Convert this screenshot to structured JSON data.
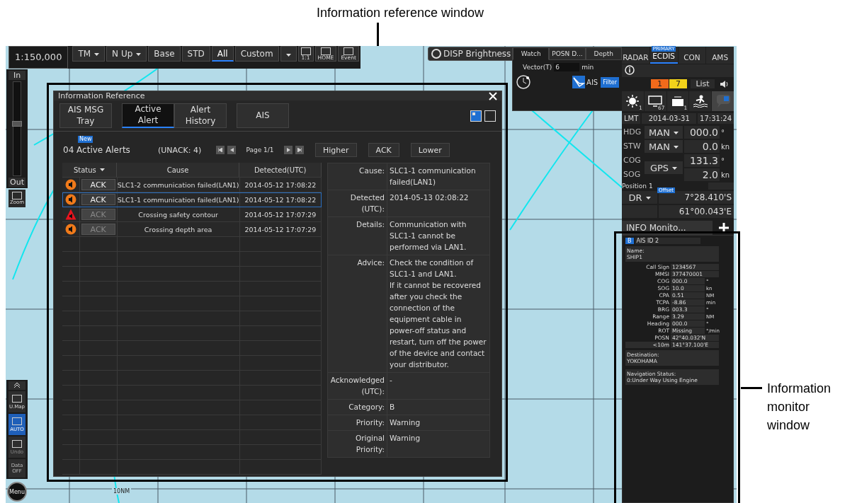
{
  "callouts": [
    {
      "text": "Information reference window"
    },
    {
      "text": "Information monitor window"
    }
  ],
  "toolbar": {
    "scale": "1:150,000",
    "motion": "TM",
    "orientation": "N Up",
    "display_modes": [
      {
        "label": "Base",
        "selected": false
      },
      {
        "label": "STD",
        "selected": false
      },
      {
        "label": "All",
        "selected": true
      },
      {
        "label": "Custom",
        "selected": false
      }
    ],
    "icon_captions": [
      "1:1",
      "HOME",
      "Event"
    ],
    "brightness": "DISP Brightness"
  },
  "left_bar": {
    "zoom_in": "In",
    "zoom_out": "Out",
    "level": 0.55,
    "zoom": "Zoom",
    "tools": [
      {
        "label": "U.Map",
        "selected": false,
        "disabled": false
      },
      {
        "label": "AUTO",
        "selected": true,
        "disabled": false
      },
      {
        "label": "Undo",
        "selected": false,
        "disabled": true
      }
    ],
    "data": "Data OFF",
    "menu": "Menu"
  },
  "map": {
    "scale_label": "10NM"
  },
  "watch_panel": {
    "tabs": [
      {
        "label": "Watch",
        "selected": true
      },
      {
        "label": "POSN D...",
        "selected": false
      },
      {
        "label": "Depth",
        "selected": false
      }
    ],
    "vector_label": "Vector(T)",
    "vector_value": "6",
    "vector_unit": "min",
    "ais": "AIS",
    "filter": "Filter"
  },
  "right_panel": {
    "tabs": [
      {
        "label": "RADAR",
        "selected": false
      },
      {
        "label": "ECDIS",
        "selected": true,
        "badge": "PRIMARY"
      },
      {
        "label": "CON",
        "selected": false
      },
      {
        "label": "AMS",
        "selected": false
      }
    ],
    "alert_counts": [
      {
        "value": "1",
        "color": "#f26a1b"
      },
      {
        "value": "7",
        "color": "#f2d21a"
      }
    ],
    "list": "List",
    "icon_counts": [
      "1",
      "67",
      "1"
    ],
    "clock": {
      "zone": "LMT",
      "date": "2014-03-31",
      "time": "17:31:24"
    },
    "sensors": [
      {
        "label": "HDG",
        "source": "MAN",
        "value": "000.0",
        "unit": "°"
      },
      {
        "label": "STW",
        "source": "MAN",
        "value": "0.0",
        "unit": "kn"
      },
      {
        "label": "COG",
        "source": "GPS",
        "value": "131.3",
        "unit": "°"
      },
      {
        "label": "SOG",
        "value": "2.0",
        "unit": "kn"
      }
    ],
    "position": {
      "label": "Position 1",
      "mode": "DR",
      "badge": "Offset",
      "lat": "7°28.410'S",
      "lon": "61°00.043'E"
    },
    "info_monitor_tab": "INFO Monito..."
  },
  "info_reference": {
    "title": "Information Reference",
    "tabs": [
      {
        "label": "AIS MSG Tray",
        "selected": false
      },
      {
        "label": "Active Alert",
        "selected": true
      },
      {
        "label": "Alert History",
        "selected": false
      },
      {
        "label": "AIS",
        "selected": false
      }
    ],
    "new_badge": "New",
    "count": "04 Active Alerts",
    "unack": "(UNACK: 4)",
    "page": "Page 1/1",
    "actions": [
      "Higher",
      "ACK",
      "Lower"
    ],
    "columns": [
      "Status",
      "Cause",
      "Detected(UTC)"
    ],
    "rows": [
      {
        "kind": "warning",
        "ack": "ACK",
        "ack_disabled": false,
        "selected": false,
        "cause": "SLC1-2 communication failed(LAN1)",
        "detected": "2014-05-12 17:08:22"
      },
      {
        "kind": "warning",
        "ack": "ACK",
        "ack_disabled": false,
        "selected": true,
        "cause": "SLC1-1 communication failed(LAN1)",
        "detected": "2014-05-12 17:08:22"
      },
      {
        "kind": "alarm",
        "ack": "ACK",
        "ack_disabled": true,
        "selected": false,
        "cause": "Crossing safety contour",
        "detected": "2014-05-12 17:07:29"
      },
      {
        "kind": "warning",
        "ack": "ACK",
        "ack_disabled": true,
        "selected": false,
        "cause": "Crossing depth area",
        "detected": "2014-05-12 17:07:29"
      }
    ],
    "details": [
      {
        "label": "Cause:",
        "value": "SLC1-1 communication failed(LAN1)"
      },
      {
        "label": "Detected (UTC):",
        "value": "2014-05-13 02:08:22"
      },
      {
        "label": "Details:",
        "value": "Communication with SLC1-1 cannot be performed via LAN1."
      },
      {
        "label": "Advice:",
        "value": "Check the condition of SLC1-1 and LAN1.\nIf it cannot be recovered after you check the connection of the equipment cable in power-off status and restart, turn off the power of the device and contact your distributor."
      },
      {
        "label": "Acknowledged (UTC):",
        "value": "-"
      },
      {
        "label": "Category:",
        "value": "B"
      },
      {
        "label": "Priority:",
        "value": "Warning"
      },
      {
        "label": "Original Priority:",
        "value": "Warning"
      }
    ]
  },
  "info_monitor": {
    "tag": "B",
    "title": "AIS ID 2",
    "name_label": "Name:",
    "name": "SHIP1",
    "fields": [
      {
        "label": "Call Sign",
        "value": "1234567"
      },
      {
        "label": "MMSI",
        "value": "377470001"
      },
      {
        "label": "COG",
        "value": "000.0",
        "unit": "°"
      },
      {
        "label": "SOG",
        "value": "10.0",
        "unit": "kn"
      },
      {
        "label": "CPA",
        "value": "0.51",
        "unit": "NM"
      },
      {
        "label": "TCPA",
        "value": "-8.86",
        "unit": "min"
      },
      {
        "label": "BRG",
        "value": "003.3",
        "unit": "°"
      },
      {
        "label": "Range",
        "value": "3.29",
        "unit": "NM"
      },
      {
        "label": "Heading",
        "value": "000.0",
        "unit": "°"
      },
      {
        "label": "ROT",
        "value": "Missing",
        "unit": "°/min"
      },
      {
        "label": "POSN",
        "value": "42°40.032'N"
      },
      {
        "label": "<10m",
        "value": "141°37.100'E"
      }
    ],
    "destination_label": "Destination:",
    "destination": "YOKOHAMA",
    "status_label": "Navigation Status:",
    "status": "0:Under Way Using Engine"
  }
}
